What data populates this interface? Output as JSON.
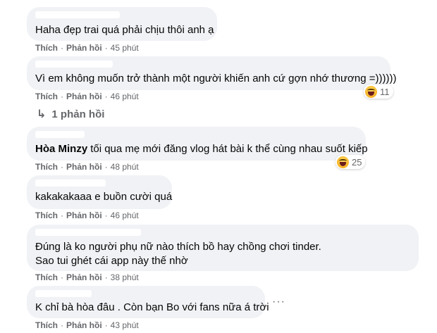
{
  "actions": {
    "like": "Thích",
    "reply": "Phản hồi",
    "separator": "·"
  },
  "comments": [
    {
      "author": "",
      "text": "Haha đẹp trai quá phải chịu thôi anh ạ",
      "time": "45 phút"
    },
    {
      "author": "",
      "text": "Vì em không muốn trở thành một người khiến anh cứ gợn nhớ thương =))))))",
      "time": "46 phút",
      "reaction": {
        "icon": "haha-reaction-icon",
        "count": "11"
      },
      "replies_label": "1 phản hồi"
    },
    {
      "author": "Hòa Minzy",
      "text": "tối qua mẹ mới đăng vlog hát bài k thể cùng nhau suốt kiếp",
      "time": "48 phút",
      "reaction": {
        "icon": "haha-reaction-icon",
        "count": "25"
      }
    },
    {
      "author": "",
      "text": "kakakakaaa e buồn cười quá",
      "time": "46 phút"
    },
    {
      "author": "",
      "text": "Đúng là ko người phụ nữ nào thích bồ hay chồng chơi tinder. Sao tui ghét cái app này thế nhờ",
      "time": "38 phút"
    },
    {
      "author": "",
      "text": "K chỉ bà hòa đâu . Còn bạn Bo với fans nữa á trời",
      "time": "43 phút"
    }
  ],
  "icons": {
    "reply_arrow": "↳",
    "more": "···"
  },
  "colors": {
    "bubble": "#f0f2f5",
    "meta": "#65676b",
    "text": "#050505"
  }
}
